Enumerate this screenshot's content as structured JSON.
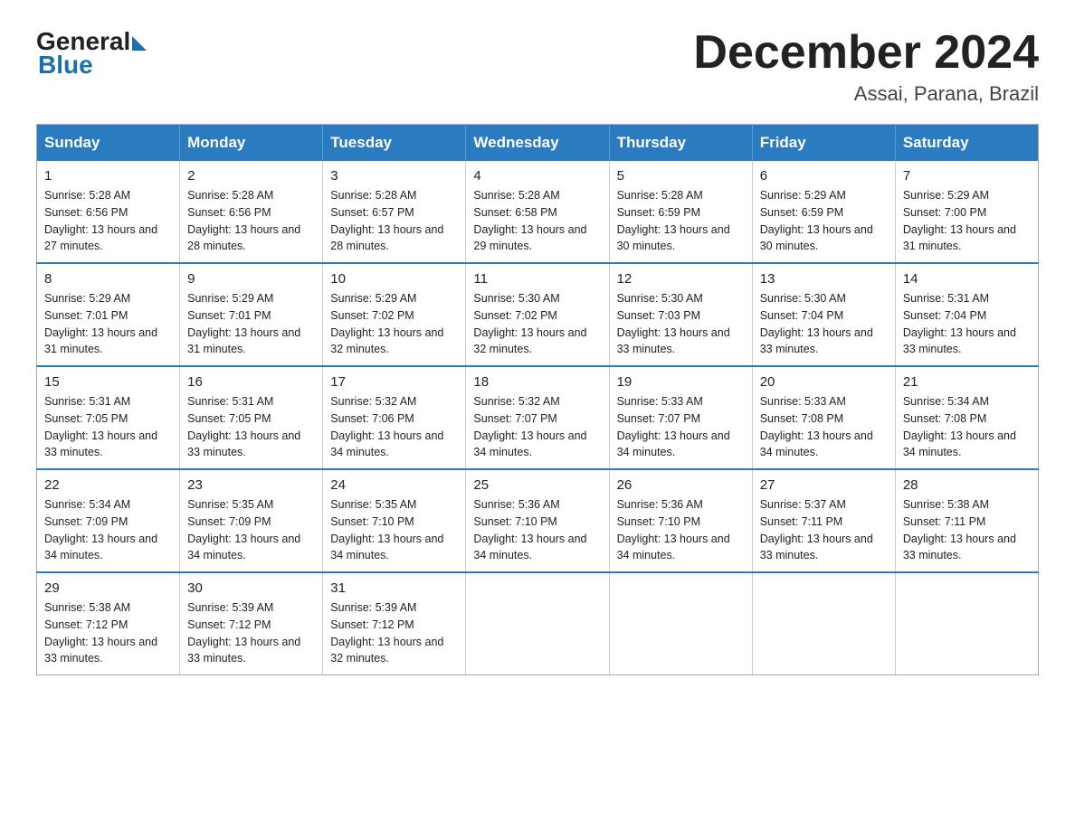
{
  "header": {
    "logo_general": "General",
    "logo_blue": "Blue",
    "month_title": "December 2024",
    "location": "Assai, Parana, Brazil"
  },
  "columns": [
    "Sunday",
    "Monday",
    "Tuesday",
    "Wednesday",
    "Thursday",
    "Friday",
    "Saturday"
  ],
  "weeks": [
    [
      {
        "day": "1",
        "sunrise": "Sunrise: 5:28 AM",
        "sunset": "Sunset: 6:56 PM",
        "daylight": "Daylight: 13 hours and 27 minutes."
      },
      {
        "day": "2",
        "sunrise": "Sunrise: 5:28 AM",
        "sunset": "Sunset: 6:56 PM",
        "daylight": "Daylight: 13 hours and 28 minutes."
      },
      {
        "day": "3",
        "sunrise": "Sunrise: 5:28 AM",
        "sunset": "Sunset: 6:57 PM",
        "daylight": "Daylight: 13 hours and 28 minutes."
      },
      {
        "day": "4",
        "sunrise": "Sunrise: 5:28 AM",
        "sunset": "Sunset: 6:58 PM",
        "daylight": "Daylight: 13 hours and 29 minutes."
      },
      {
        "day": "5",
        "sunrise": "Sunrise: 5:28 AM",
        "sunset": "Sunset: 6:59 PM",
        "daylight": "Daylight: 13 hours and 30 minutes."
      },
      {
        "day": "6",
        "sunrise": "Sunrise: 5:29 AM",
        "sunset": "Sunset: 6:59 PM",
        "daylight": "Daylight: 13 hours and 30 minutes."
      },
      {
        "day": "7",
        "sunrise": "Sunrise: 5:29 AM",
        "sunset": "Sunset: 7:00 PM",
        "daylight": "Daylight: 13 hours and 31 minutes."
      }
    ],
    [
      {
        "day": "8",
        "sunrise": "Sunrise: 5:29 AM",
        "sunset": "Sunset: 7:01 PM",
        "daylight": "Daylight: 13 hours and 31 minutes."
      },
      {
        "day": "9",
        "sunrise": "Sunrise: 5:29 AM",
        "sunset": "Sunset: 7:01 PM",
        "daylight": "Daylight: 13 hours and 31 minutes."
      },
      {
        "day": "10",
        "sunrise": "Sunrise: 5:29 AM",
        "sunset": "Sunset: 7:02 PM",
        "daylight": "Daylight: 13 hours and 32 minutes."
      },
      {
        "day": "11",
        "sunrise": "Sunrise: 5:30 AM",
        "sunset": "Sunset: 7:02 PM",
        "daylight": "Daylight: 13 hours and 32 minutes."
      },
      {
        "day": "12",
        "sunrise": "Sunrise: 5:30 AM",
        "sunset": "Sunset: 7:03 PM",
        "daylight": "Daylight: 13 hours and 33 minutes."
      },
      {
        "day": "13",
        "sunrise": "Sunrise: 5:30 AM",
        "sunset": "Sunset: 7:04 PM",
        "daylight": "Daylight: 13 hours and 33 minutes."
      },
      {
        "day": "14",
        "sunrise": "Sunrise: 5:31 AM",
        "sunset": "Sunset: 7:04 PM",
        "daylight": "Daylight: 13 hours and 33 minutes."
      }
    ],
    [
      {
        "day": "15",
        "sunrise": "Sunrise: 5:31 AM",
        "sunset": "Sunset: 7:05 PM",
        "daylight": "Daylight: 13 hours and 33 minutes."
      },
      {
        "day": "16",
        "sunrise": "Sunrise: 5:31 AM",
        "sunset": "Sunset: 7:05 PM",
        "daylight": "Daylight: 13 hours and 33 minutes."
      },
      {
        "day": "17",
        "sunrise": "Sunrise: 5:32 AM",
        "sunset": "Sunset: 7:06 PM",
        "daylight": "Daylight: 13 hours and 34 minutes."
      },
      {
        "day": "18",
        "sunrise": "Sunrise: 5:32 AM",
        "sunset": "Sunset: 7:07 PM",
        "daylight": "Daylight: 13 hours and 34 minutes."
      },
      {
        "day": "19",
        "sunrise": "Sunrise: 5:33 AM",
        "sunset": "Sunset: 7:07 PM",
        "daylight": "Daylight: 13 hours and 34 minutes."
      },
      {
        "day": "20",
        "sunrise": "Sunrise: 5:33 AM",
        "sunset": "Sunset: 7:08 PM",
        "daylight": "Daylight: 13 hours and 34 minutes."
      },
      {
        "day": "21",
        "sunrise": "Sunrise: 5:34 AM",
        "sunset": "Sunset: 7:08 PM",
        "daylight": "Daylight: 13 hours and 34 minutes."
      }
    ],
    [
      {
        "day": "22",
        "sunrise": "Sunrise: 5:34 AM",
        "sunset": "Sunset: 7:09 PM",
        "daylight": "Daylight: 13 hours and 34 minutes."
      },
      {
        "day": "23",
        "sunrise": "Sunrise: 5:35 AM",
        "sunset": "Sunset: 7:09 PM",
        "daylight": "Daylight: 13 hours and 34 minutes."
      },
      {
        "day": "24",
        "sunrise": "Sunrise: 5:35 AM",
        "sunset": "Sunset: 7:10 PM",
        "daylight": "Daylight: 13 hours and 34 minutes."
      },
      {
        "day": "25",
        "sunrise": "Sunrise: 5:36 AM",
        "sunset": "Sunset: 7:10 PM",
        "daylight": "Daylight: 13 hours and 34 minutes."
      },
      {
        "day": "26",
        "sunrise": "Sunrise: 5:36 AM",
        "sunset": "Sunset: 7:10 PM",
        "daylight": "Daylight: 13 hours and 34 minutes."
      },
      {
        "day": "27",
        "sunrise": "Sunrise: 5:37 AM",
        "sunset": "Sunset: 7:11 PM",
        "daylight": "Daylight: 13 hours and 33 minutes."
      },
      {
        "day": "28",
        "sunrise": "Sunrise: 5:38 AM",
        "sunset": "Sunset: 7:11 PM",
        "daylight": "Daylight: 13 hours and 33 minutes."
      }
    ],
    [
      {
        "day": "29",
        "sunrise": "Sunrise: 5:38 AM",
        "sunset": "Sunset: 7:12 PM",
        "daylight": "Daylight: 13 hours and 33 minutes."
      },
      {
        "day": "30",
        "sunrise": "Sunrise: 5:39 AM",
        "sunset": "Sunset: 7:12 PM",
        "daylight": "Daylight: 13 hours and 33 minutes."
      },
      {
        "day": "31",
        "sunrise": "Sunrise: 5:39 AM",
        "sunset": "Sunset: 7:12 PM",
        "daylight": "Daylight: 13 hours and 32 minutes."
      },
      null,
      null,
      null,
      null
    ]
  ]
}
